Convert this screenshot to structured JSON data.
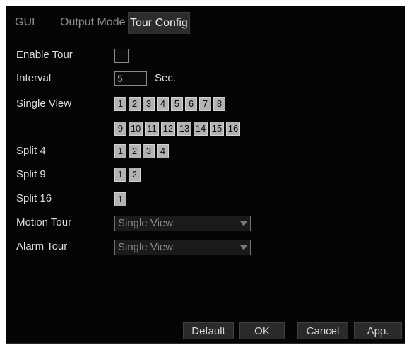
{
  "tabs": [
    {
      "label": "GUI"
    },
    {
      "label": "Output Mode"
    },
    {
      "label": "Tour Config",
      "active": true
    }
  ],
  "form": {
    "enable_tour": {
      "label": "Enable Tour",
      "checked": false
    },
    "interval": {
      "label": "Interval",
      "value": "5",
      "unit": "Sec."
    },
    "single_view": {
      "label": "Single View",
      "row1": [
        "1",
        "2",
        "3",
        "4",
        "5",
        "6",
        "7",
        "8"
      ],
      "row2": [
        "9",
        "10",
        "11",
        "12",
        "13",
        "14",
        "15",
        "16"
      ]
    },
    "split4": {
      "label": "Split 4",
      "buttons": [
        "1",
        "2",
        "3",
        "4"
      ]
    },
    "split9": {
      "label": "Split 9",
      "buttons": [
        "1",
        "2"
      ]
    },
    "split16": {
      "label": "Split 16",
      "buttons": [
        "1"
      ]
    },
    "motion_tour": {
      "label": "Motion Tour",
      "value": "Single View"
    },
    "alarm_tour": {
      "label": "Alarm Tour",
      "value": "Single View"
    }
  },
  "footer": {
    "default_label": "Default",
    "ok_label": "OK",
    "cancel_label": "Cancel",
    "apply_label": "App."
  }
}
